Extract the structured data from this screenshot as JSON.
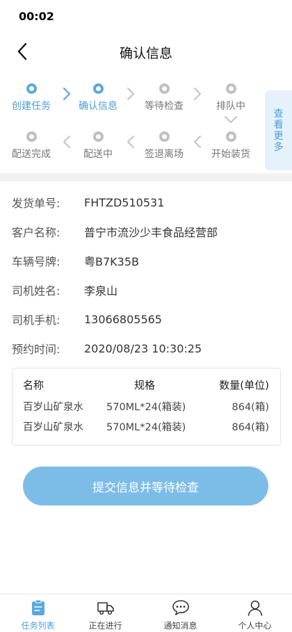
{
  "status": {
    "time": "00:02"
  },
  "nav": {
    "title": "确认信息"
  },
  "steps": {
    "row1": [
      {
        "label": "创建任务",
        "active": true
      },
      {
        "label": "确认信息",
        "active": true
      },
      {
        "label": "等待检查",
        "active": false
      },
      {
        "label": "排队中",
        "active": false
      }
    ],
    "row2": [
      {
        "label": "配送完成",
        "active": false
      },
      {
        "label": "配送中",
        "active": false
      },
      {
        "label": "签退离场",
        "active": false
      },
      {
        "label": "开始装货",
        "active": false
      }
    ],
    "more": "查看更多",
    "active_color": "#5aa9dd",
    "inactive_color": "#bfbfbf"
  },
  "info": [
    {
      "label": "发货单号:",
      "value": "FHTZD510531"
    },
    {
      "label": "客户名称:",
      "value": "普宁市流沙少丰食品经营部"
    },
    {
      "label": "车辆号牌:",
      "value": "粤B7K35B"
    },
    {
      "label": "司机姓名:",
      "value": "李泉山"
    },
    {
      "label": "司机手机:",
      "value": "13066805565"
    },
    {
      "label": "预约时间:",
      "value": "2020/08/23 10:30:25"
    }
  ],
  "goods": {
    "headers": [
      "名称",
      "规格",
      "数量(单位)"
    ],
    "rows": [
      [
        "百岁山矿泉水",
        "570ML*24(箱装)",
        "864(箱)"
      ],
      [
        "百岁山矿泉水",
        "570ML*24(箱装)",
        "864(箱)"
      ]
    ]
  },
  "submit": {
    "label": "提交信息并等待检查",
    "color": "#7cbde8"
  },
  "tabbar": [
    {
      "label": "任务列表",
      "icon": "clipboard-icon",
      "active": true
    },
    {
      "label": "正在进行",
      "icon": "truck-icon",
      "active": false
    },
    {
      "label": "通知消息",
      "icon": "message-icon",
      "active": false
    },
    {
      "label": "个人中心",
      "icon": "user-icon",
      "active": false
    }
  ]
}
